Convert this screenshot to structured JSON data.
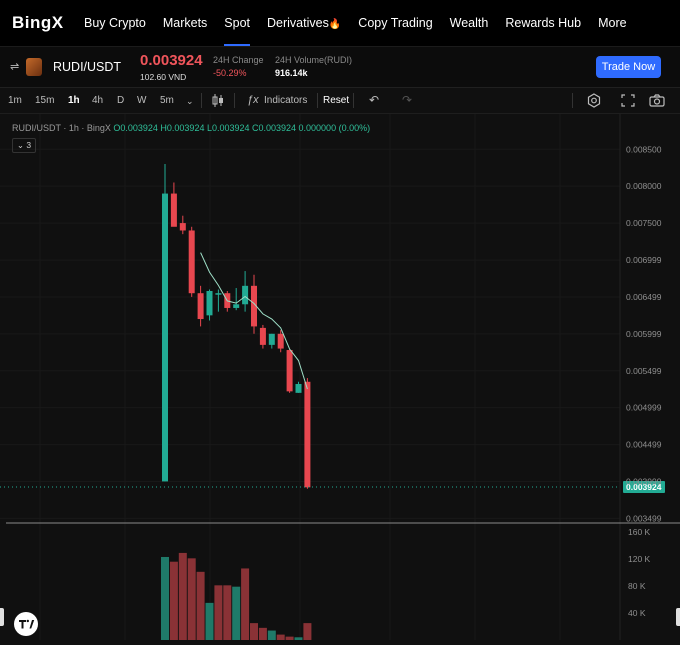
{
  "nav": {
    "logo": "BingX",
    "items": [
      {
        "label": "Buy Crypto",
        "active": false
      },
      {
        "label": "Markets",
        "active": false
      },
      {
        "label": "Spot",
        "active": true
      },
      {
        "label": "Derivatives",
        "active": false,
        "icon": "fire-icon"
      },
      {
        "label": "Copy Trading",
        "active": false
      },
      {
        "label": "Wealth",
        "active": false
      },
      {
        "label": "Rewards Hub",
        "active": false
      },
      {
        "label": "More",
        "active": false
      }
    ]
  },
  "ticker": {
    "pair": "RUDI/USDT",
    "price": "0.003924",
    "price_fiat": "102.60 VND",
    "change_label": "24H Change",
    "change_value": "-50.29%",
    "volume_label": "24H Volume(RUDI)",
    "volume_value": "916.14k",
    "trade_button": "Trade Now"
  },
  "toolbar": {
    "intervals": [
      "1m",
      "15m",
      "1h",
      "4h",
      "D",
      "W",
      "5m"
    ],
    "active_interval": "1h",
    "indicators_label": "Indicators",
    "reset_label": "Reset"
  },
  "chart": {
    "legend_title": "RUDI/USDT · 1h · BingX",
    "legend_ohlc": "O0.003924 H0.003924 L0.003924 C0.003924 0.000000 (0.00%)",
    "indicator_count": "3",
    "last_price_tag": "0.003924",
    "colors": {
      "up": "#22ab94",
      "down": "#e8474f",
      "ma": "#9fe0c8"
    }
  },
  "chart_data": {
    "type": "candlestick",
    "price_axis_ticks": [
      "0.008500",
      "0.008000",
      "0.007500",
      "0.006999",
      "0.006499",
      "0.005999",
      "0.005499",
      "0.004999",
      "0.004499",
      "0.003999",
      "0.003499"
    ],
    "ylim": [
      0.00345,
      0.00868
    ],
    "candles": [
      {
        "o": 0.004,
        "h": 0.0083,
        "l": 0.004,
        "c": 0.0079
      },
      {
        "o": 0.0079,
        "h": 0.00805,
        "l": 0.0075,
        "c": 0.00745
      },
      {
        "o": 0.0075,
        "h": 0.0076,
        "l": 0.00735,
        "c": 0.0074
      },
      {
        "o": 0.0074,
        "h": 0.00745,
        "l": 0.0065,
        "c": 0.00655
      },
      {
        "o": 0.00655,
        "h": 0.00665,
        "l": 0.0061,
        "c": 0.0062
      },
      {
        "o": 0.00625,
        "h": 0.0066,
        "l": 0.00618,
        "c": 0.00658
      },
      {
        "o": 0.00655,
        "h": 0.0066,
        "l": 0.0063,
        "c": 0.00655
      },
      {
        "o": 0.00655,
        "h": 0.00658,
        "l": 0.0063,
        "c": 0.00635
      },
      {
        "o": 0.00635,
        "h": 0.00662,
        "l": 0.00632,
        "c": 0.0064
      },
      {
        "o": 0.0064,
        "h": 0.00685,
        "l": 0.0063,
        "c": 0.00665
      },
      {
        "o": 0.00665,
        "h": 0.0068,
        "l": 0.006,
        "c": 0.0061
      },
      {
        "o": 0.00608,
        "h": 0.00612,
        "l": 0.0058,
        "c": 0.00585
      },
      {
        "o": 0.00585,
        "h": 0.006,
        "l": 0.0058,
        "c": 0.006
      },
      {
        "o": 0.006,
        "h": 0.00605,
        "l": 0.00575,
        "c": 0.0058
      },
      {
        "o": 0.00578,
        "h": 0.0058,
        "l": 0.0052,
        "c": 0.00522
      },
      {
        "o": 0.0052,
        "h": 0.00535,
        "l": 0.0052,
        "c": 0.00532
      },
      {
        "o": 0.00535,
        "h": 0.0054,
        "l": 0.0039,
        "c": 0.00392
      }
    ],
    "volume_axis_ticks": [
      "160 K",
      "120 K",
      "80 K",
      "40 K"
    ],
    "volume_ylim": [
      0,
      160000
    ],
    "volumes": [
      {
        "v": 123000,
        "up": true
      },
      {
        "v": 116000,
        "up": false
      },
      {
        "v": 129000,
        "up": false
      },
      {
        "v": 121000,
        "up": false
      },
      {
        "v": 101000,
        "up": false
      },
      {
        "v": 55000,
        "up": true
      },
      {
        "v": 81000,
        "up": false
      },
      {
        "v": 81000,
        "up": false
      },
      {
        "v": 79000,
        "up": true
      },
      {
        "v": 106000,
        "up": false
      },
      {
        "v": 25000,
        "up": false
      },
      {
        "v": 18000,
        "up": false
      },
      {
        "v": 14000,
        "up": true
      },
      {
        "v": 8000,
        "up": false
      },
      {
        "v": 5000,
        "up": false
      },
      {
        "v": 4000,
        "up": true
      },
      {
        "v": 25000,
        "up": false
      }
    ]
  }
}
